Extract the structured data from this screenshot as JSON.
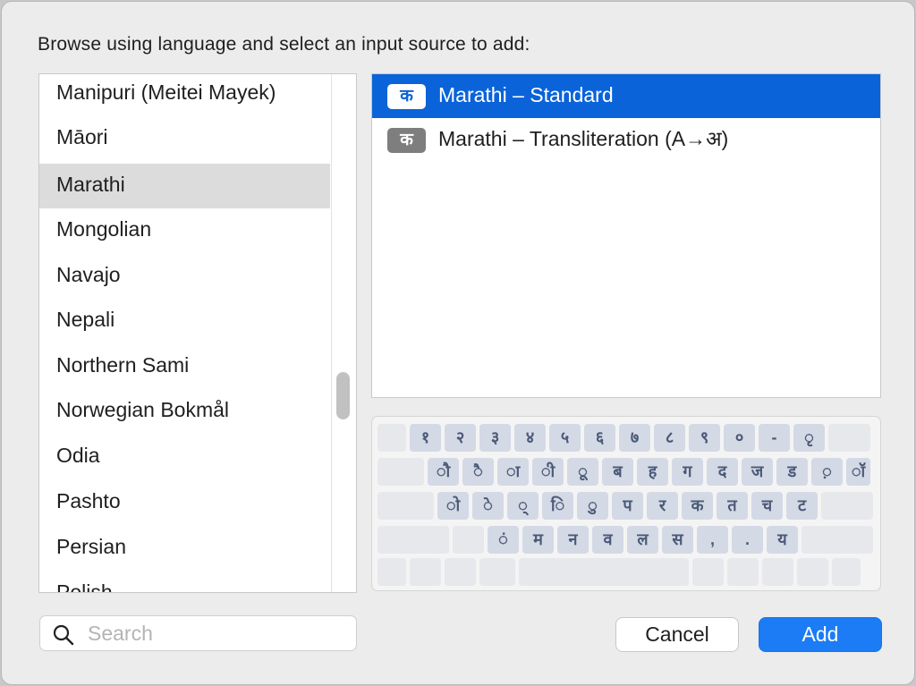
{
  "dialog": {
    "prompt": "Browse using language and select an input source to add:"
  },
  "languages": [
    {
      "label": "Manipuri (Meitei Mayek)",
      "selected": false
    },
    {
      "label": "Māori",
      "selected": false
    },
    {
      "label": "Marathi",
      "selected": true
    },
    {
      "label": "Mongolian",
      "selected": false
    },
    {
      "label": "Navajo",
      "selected": false
    },
    {
      "label": "Nepali",
      "selected": false
    },
    {
      "label": "Northern Sami",
      "selected": false
    },
    {
      "label": "Norwegian Bokmål",
      "selected": false
    },
    {
      "label": "Odia",
      "selected": false
    },
    {
      "label": "Pashto",
      "selected": false
    },
    {
      "label": "Persian",
      "selected": false
    },
    {
      "label": "Polish",
      "selected": false
    }
  ],
  "input_sources": [
    {
      "badge": "क",
      "label": "Marathi – Standard",
      "selected": true
    },
    {
      "badge": "क",
      "label": "Marathi – Transliteration (A→अ)",
      "selected": false
    }
  ],
  "keyboard": {
    "rows": [
      [
        "",
        "१",
        "२",
        "३",
        "४",
        "५",
        "६",
        "७",
        "८",
        "९",
        "०",
        "-",
        "ृ",
        ""
      ],
      [
        "",
        "ौ",
        "ै",
        "ा",
        "ी",
        "ू",
        "ब",
        "ह",
        "ग",
        "द",
        "ज",
        "ड",
        "़",
        "ॉ"
      ],
      [
        "",
        "ो",
        "े",
        "्",
        "ि",
        "ु",
        "प",
        "र",
        "क",
        "त",
        "च",
        "ट",
        ""
      ],
      [
        "",
        "",
        "ं",
        "म",
        "न",
        "व",
        "ल",
        "स",
        ",",
        ".",
        "य",
        ""
      ],
      [
        "",
        "",
        "",
        "",
        "",
        "",
        "",
        "",
        "",
        ""
      ]
    ]
  },
  "search": {
    "placeholder": "Search",
    "value": ""
  },
  "buttons": {
    "cancel": "Cancel",
    "add": "Add"
  },
  "colors": {
    "accent": "#0a63d9",
    "add_button": "#1b7cf5",
    "list_selection": "#dcdcdc",
    "key_fill": "#d4d9e6"
  },
  "icons": {
    "search": "magnifying-glass"
  }
}
